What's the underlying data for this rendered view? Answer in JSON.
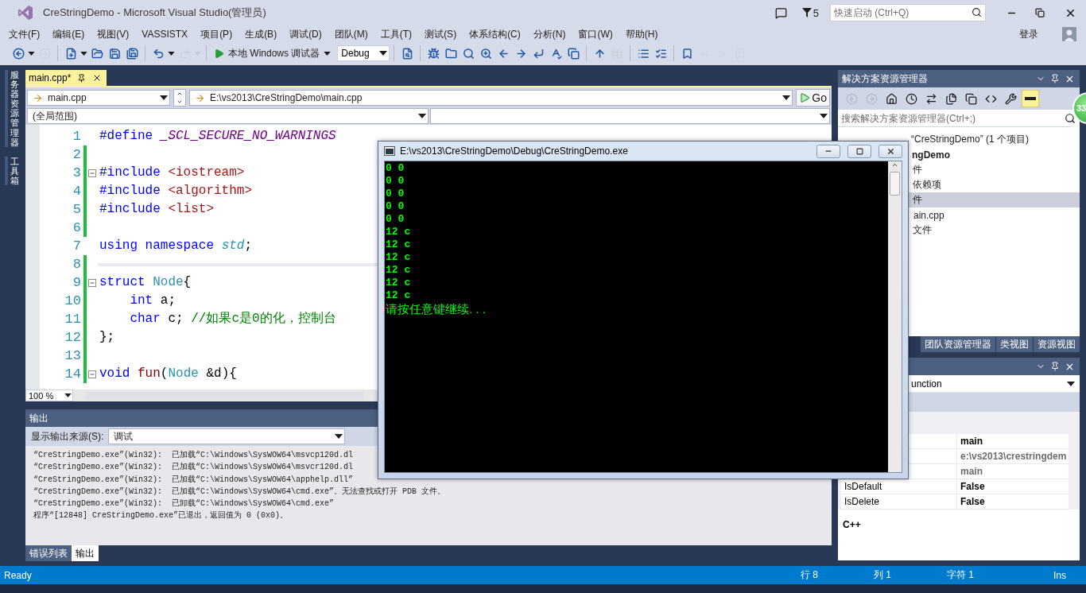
{
  "window": {
    "title": "CreStringDemo - Microsoft Visual Studio(管理员)",
    "notification_count": "5",
    "quick_launch": {
      "placeholder": "快速启动 (Ctrl+Q)"
    }
  },
  "menu": {
    "items": [
      "文件(F)",
      "编辑(E)",
      "视图(V)",
      "VASSISTX",
      "项目(P)",
      "生成(B)",
      "调试(D)",
      "团队(M)",
      "工具(T)",
      "测试(S)",
      "体系结构(C)",
      "分析(N)",
      "窗口(W)",
      "帮助(H)"
    ],
    "sign_in": "登录"
  },
  "toolbar": {
    "items": [
      {
        "kind": "icon",
        "disabled": false
      },
      {
        "kind": "caret",
        "disabled": false
      },
      {
        "kind": "icon",
        "disabled": true
      },
      {
        "kind": "separator"
      },
      {
        "kind": "icon",
        "disabled": false
      },
      {
        "kind": "caret",
        "disabled": false
      },
      {
        "kind": "icon",
        "disabled": false
      },
      {
        "kind": "icon",
        "disabled": false
      },
      {
        "kind": "icon",
        "disabled": false
      },
      {
        "kind": "separator"
      },
      {
        "kind": "icon",
        "disabled": false
      },
      {
        "kind": "caret",
        "disabled": false
      },
      {
        "kind": "icon",
        "disabled": true
      },
      {
        "kind": "caret",
        "disabled": true
      },
      {
        "kind": "separator"
      },
      {
        "kind": "run",
        "label": "本地 Windows 调试器"
      },
      {
        "kind": "select",
        "value": "Debug"
      },
      {
        "kind": "separator"
      },
      {
        "kind": "icon",
        "disabled": false
      },
      {
        "kind": "separator"
      },
      {
        "kind": "icon",
        "disabled": false
      },
      {
        "kind": "icon",
        "disabled": false
      },
      {
        "kind": "icon",
        "disabled": false
      },
      {
        "kind": "icon",
        "disabled": false
      },
      {
        "kind": "icon",
        "disabled": false
      },
      {
        "kind": "icon",
        "disabled": false
      },
      {
        "kind": "icon",
        "disabled": false
      },
      {
        "kind": "icon",
        "disabled": false
      },
      {
        "kind": "icon",
        "disabled": false
      },
      {
        "kind": "separator"
      },
      {
        "kind": "icon",
        "disabled": false
      },
      {
        "kind": "icon",
        "disabled": true
      },
      {
        "kind": "separator"
      },
      {
        "kind": "icon",
        "disabled": false
      },
      {
        "kind": "icon",
        "disabled": false
      },
      {
        "kind": "separator"
      },
      {
        "kind": "icon",
        "disabled": false
      },
      {
        "kind": "icon",
        "disabled": true
      },
      {
        "kind": "icon",
        "disabled": true
      },
      {
        "kind": "icon",
        "disabled": true
      }
    ]
  },
  "side_tabs": [
    "服务器资源管理器",
    "工具箱"
  ],
  "editor": {
    "tab": {
      "label": "main.cpp*",
      "selected": true
    },
    "file_dropdown": "main.cpp",
    "path_dropdown": "E:\\vs2013\\CreStringDemo\\main.cpp",
    "go_button": "Go",
    "scope_dropdown": "(全局范围)",
    "zoom": "100 %",
    "lines": [
      {
        "number": "1",
        "changed": false,
        "collapsible": false,
        "current": false,
        "tokens": [
          {
            "kind": "keyword",
            "text": "#define"
          },
          {
            "kind": "macro",
            "text": "_SCL_SECURE_NO_WARNINGS",
            "spaced": true
          }
        ]
      },
      {
        "number": "2",
        "changed": true,
        "collapsible": false,
        "current": false
      },
      {
        "number": "3",
        "changed": true,
        "collapsible": true,
        "current": false,
        "tokens": [
          {
            "kind": "keyword",
            "text": "#include"
          },
          {
            "kind": "string",
            "text": "<iostream>",
            "spaced": true
          }
        ]
      },
      {
        "number": "4",
        "changed": true,
        "collapsible": false,
        "current": false,
        "tokens": [
          {
            "kind": "keyword",
            "text": "#include"
          },
          {
            "kind": "string",
            "text": "<algorithm>",
            "spaced": true
          }
        ]
      },
      {
        "number": "5",
        "changed": true,
        "collapsible": false,
        "current": false,
        "tokens": [
          {
            "kind": "keyword",
            "text": "#include"
          },
          {
            "kind": "string",
            "text": "<list>",
            "spaced": true
          }
        ]
      },
      {
        "number": "6",
        "changed": true,
        "collapsible": false,
        "current": false
      },
      {
        "number": "7",
        "changed": false,
        "collapsible": false,
        "current": false,
        "tokens": [
          {
            "kind": "keyword",
            "text": "using namespace"
          },
          {
            "kind": "namespace",
            "text": "std",
            "spaced": true
          },
          {
            "kind": "plain",
            "text": ";"
          }
        ]
      },
      {
        "number": "8",
        "changed": true,
        "collapsible": false,
        "current": true
      },
      {
        "number": "9",
        "changed": true,
        "collapsible": true,
        "current": false,
        "tokens": [
          {
            "kind": "keyword",
            "text": "struct"
          },
          {
            "kind": "type",
            "text": "Node",
            "spaced": true
          },
          {
            "kind": "plain",
            "text": "{"
          }
        ]
      },
      {
        "number": "10",
        "changed": true,
        "collapsible": false,
        "current": false,
        "indented": true,
        "tokens": [
          {
            "kind": "keyword",
            "text": "int"
          },
          {
            "kind": "plain",
            "text": "a;",
            "spaced": true
          }
        ]
      },
      {
        "number": "11",
        "changed": true,
        "collapsible": false,
        "current": false,
        "indented": true,
        "tokens": [
          {
            "kind": "keyword",
            "text": "char"
          },
          {
            "kind": "plain",
            "text": "c;",
            "spaced": true
          },
          {
            "kind": "comment",
            "text": "//如果c是0的化，控制台",
            "spaced": true
          }
        ]
      },
      {
        "number": "12",
        "changed": true,
        "collapsible": false,
        "current": false,
        "tokens": [
          {
            "kind": "plain",
            "text": "};"
          }
        ]
      },
      {
        "number": "13",
        "changed": true,
        "collapsible": false,
        "current": false
      },
      {
        "number": "14",
        "changed": true,
        "collapsible": true,
        "current": false,
        "tokens": [
          {
            "kind": "keyword",
            "text": "void"
          },
          {
            "kind": "function",
            "text": "fun",
            "spaced": true
          },
          {
            "kind": "plain",
            "text": "("
          },
          {
            "kind": "type",
            "text": "Node"
          },
          {
            "kind": "plain",
            "text": "&d){",
            "spaced": true
          }
        ]
      }
    ]
  },
  "output": {
    "title": "输出",
    "source_label": "显示输出来源(S):",
    "source_value": "调试",
    "lines": [
      "“CreStringDemo.exe”(Win32):  已加载“C:\\Windows\\SysWOW64\\msvcp120d.dl",
      "“CreStringDemo.exe”(Win32):  已加载“C:\\Windows\\SysWOW64\\msvcr120d.dl",
      "“CreStringDemo.exe”(Win32):  已加载“C:\\Windows\\SysWOW64\\apphelp.dll”",
      "“CreStringDemo.exe”(Win32):  已加载“C:\\Windows\\SysWOW64\\cmd.exe”。无法查找或打开 PDB 文件。",
      "“CreStringDemo.exe”(Win32):  已卸载“C:\\Windows\\SysWOW64\\cmd.exe”",
      "程序“[12848] CreStringDemo.exe”已退出，返回值为 0 (0x0)。"
    ],
    "tabs": [
      {
        "label": "错误列表",
        "selected": false
      },
      {
        "label": "输出",
        "selected": true
      }
    ]
  },
  "solution_explorer": {
    "title": "解决方案资源管理器",
    "search_placeholder": "搜索解决方案资源管理器(Ctrl+;)",
    "tree": [
      {
        "label": "“CreStringDemo” (1 个项目)",
        "selected": false,
        "children": [
          {
            "label": "ngDemo",
            "selected": false,
            "children": [
              {
                "label": "件",
                "selected": false
              },
              {
                "label": "依赖项",
                "selected": false
              },
              {
                "label": "件",
                "selected": true,
                "children": [
                  {
                    "label": "ain.cpp",
                    "selected": false
                  }
                ]
              },
              {
                "label": "文件",
                "selected": false
              }
            ]
          }
        ]
      }
    ],
    "tabs": [
      {
        "label": "团队资源管理器",
        "selected": false
      },
      {
        "label": "类视图",
        "selected": false
      },
      {
        "label": "资源视图",
        "selected": false
      }
    ]
  },
  "properties": {
    "object_dropdown": "unction",
    "rows": [
      {
        "value": "main",
        "readonly": false
      },
      {
        "value": "e:\\vs2013\\crestringdem",
        "readonly": true
      },
      {
        "value": "main",
        "readonly": true
      },
      {
        "name": "IsDefault",
        "value": "False",
        "readonly": false
      },
      {
        "name": "IsDelete",
        "value": "False",
        "readonly": false
      }
    ],
    "description": "C++"
  },
  "console": {
    "title": "E:\\vs2013\\CreStringDemo\\Debug\\CreStringDemo.exe",
    "lines": [
      "0 0",
      "0 0",
      "0 0",
      "0 0",
      "0 0",
      "12 c",
      "12 c",
      "12 c",
      "12 c",
      "12 c",
      "12 c",
      "请按任意键继续. . ."
    ]
  },
  "notification_badge": "33",
  "status_bar": {
    "message": "Ready",
    "line": "行 8",
    "column": "列 1",
    "char": "字符 1",
    "mode": "Ins"
  }
}
